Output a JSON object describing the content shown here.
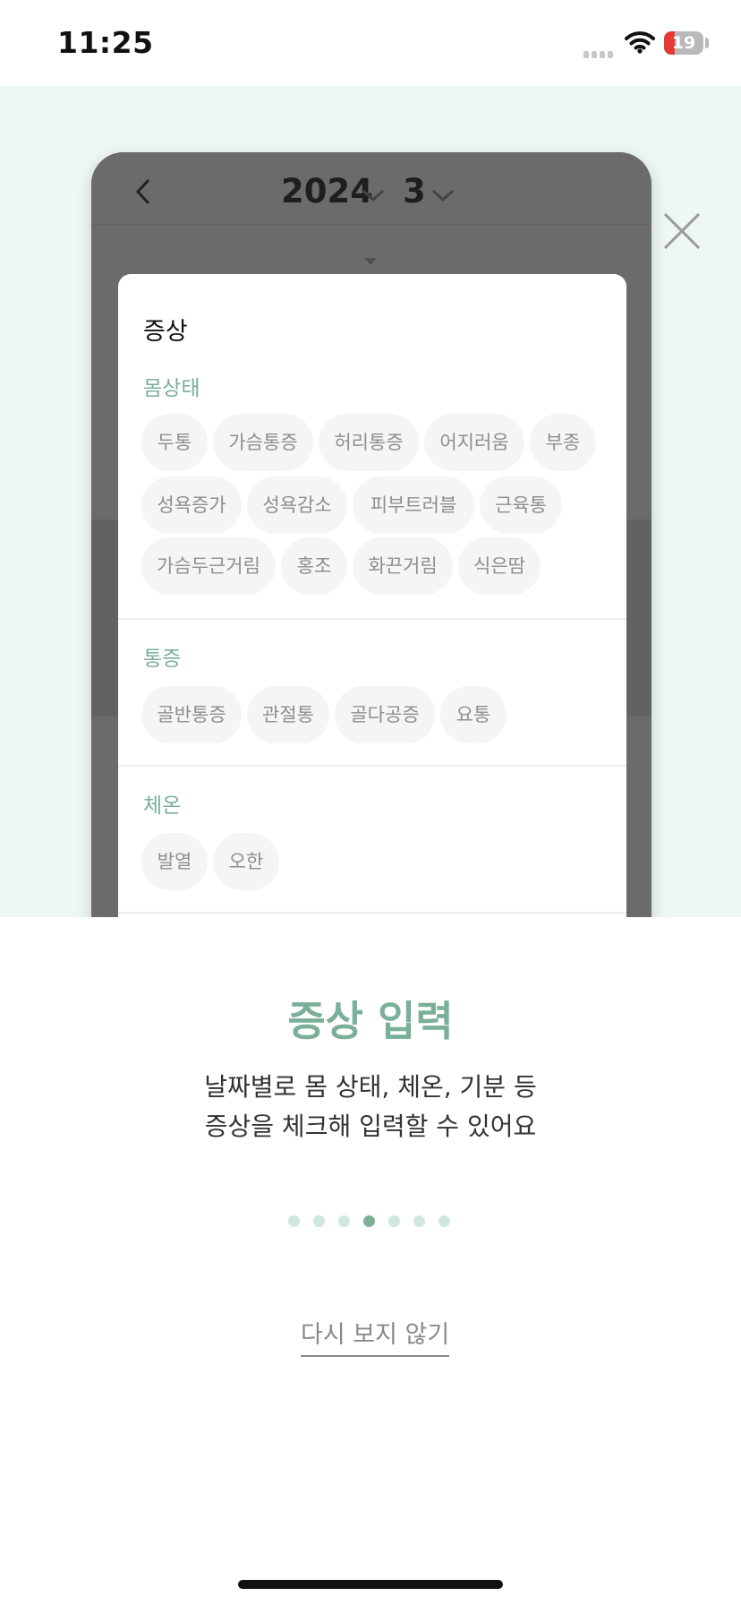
{
  "status": {
    "time": "11:25",
    "battery": "19",
    "battery_level_pct": 19
  },
  "calendar_preview": {
    "year": "2024",
    "month": "3",
    "sheet_title": "증상",
    "sections": [
      {
        "title": "몸상태",
        "chips": [
          "두통",
          "가슴통증",
          "허리통증",
          "어지러움",
          "부종",
          "성욕증가",
          "성욕감소",
          "피부트러블",
          "근육통",
          "가슴두근거림",
          "홍조",
          "화끈거림",
          "식은땀"
        ]
      },
      {
        "title": "통증",
        "chips": [
          "골반통증",
          "관절통",
          "골다공증",
          "요통"
        ]
      },
      {
        "title": "체온",
        "chips": [
          "발열",
          "오한"
        ]
      }
    ]
  },
  "info": {
    "heading": "증상 입력",
    "description_line1": "날짜별로 몸 상태, 체온, 기분 등",
    "description_line2": "증상을 체크해 입력할 수 있어요"
  },
  "pagination": {
    "total": 7,
    "active_index": 3
  },
  "dismiss_label": "다시 보지 않기",
  "icons": {
    "close": "close-icon",
    "back": "chevron-left-icon",
    "dropdown": "chevron-down-icon"
  },
  "colors": {
    "accent": "#7aaf98",
    "preview_bg": "#eef8f3",
    "overlay": "#6b6b6b"
  }
}
